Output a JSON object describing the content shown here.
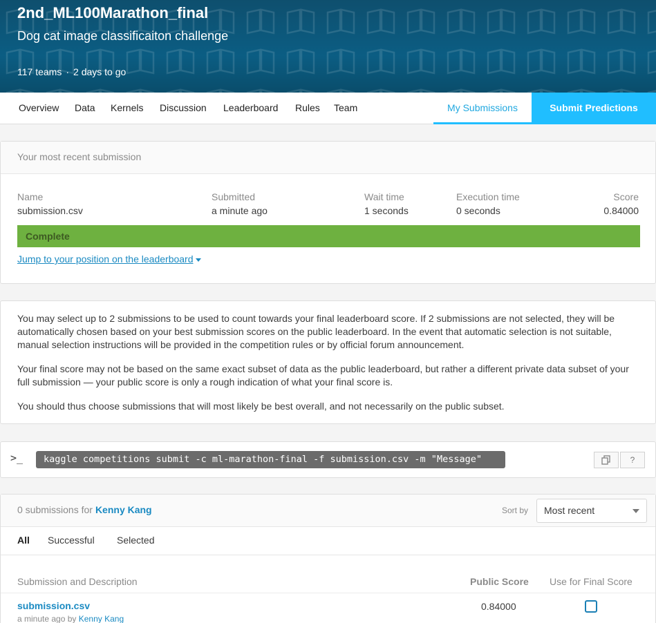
{
  "header": {
    "title": "2nd_ML100Marathon_final",
    "subtitle": "Dog cat image classificaiton challenge",
    "teams": "117 teams",
    "separator": "·",
    "deadline": "2 days to go",
    "bg_color": "#0b5d83"
  },
  "nav": {
    "items": [
      "Overview",
      "Data",
      "Kernels",
      "Discussion",
      "Leaderboard",
      "Rules",
      "Team"
    ],
    "my_submissions": "My Submissions",
    "submit_predictions": "Submit Predictions",
    "accent_color": "#20beff"
  },
  "recent": {
    "heading": "Your most recent submission",
    "columns": {
      "name": "Name",
      "submitted": "Submitted",
      "wait": "Wait time",
      "execution": "Execution time",
      "score": "Score"
    },
    "values": {
      "name": "submission.csv",
      "submitted": "a minute ago",
      "wait": "1 seconds",
      "execution": "0 seconds",
      "score": "0.84000"
    },
    "status": "Complete",
    "status_color": "#6eb140",
    "jump_link": "Jump to your position on the leaderboard"
  },
  "info": {
    "p1": "You may select up to 2 submissions to be used to count towards your final leaderboard score. If 2 submissions are not selected, they will be automatically chosen based on your best submission scores on the public leaderboard. In the event that automatic selection is not suitable, manual selection instructions will be provided in the competition rules or by official forum announcement.",
    "p2": "Your final score may not be based on the same exact subset of data as the public leaderboard, but rather a different private data subset of your full submission — your public score is only a rough indication of what your final score is.",
    "p3": "You should thus choose submissions that will most likely be best overall, and not necessarily on the public subset."
  },
  "cli": {
    "prompt": ">_",
    "command": "kaggle competitions submit -c ml-marathon-final -f submission.csv -m \"Message\"",
    "copy_icon": "copy-icon",
    "help_label": "?"
  },
  "submissions": {
    "count_text": "0 submissions for",
    "user": "Kenny Kang",
    "sort_label": "Sort by",
    "sort_value": "Most recent",
    "tabs": [
      "All",
      "Successful",
      "Selected"
    ],
    "col_desc": "Submission and Description",
    "col_public": "Public Score",
    "col_final": "Use for Final Score",
    "rows": [
      {
        "file": "submission.csv",
        "meta": "a minute ago by",
        "by": "Kenny Kang",
        "public_score": "0.84000",
        "final_selected": false
      }
    ]
  }
}
